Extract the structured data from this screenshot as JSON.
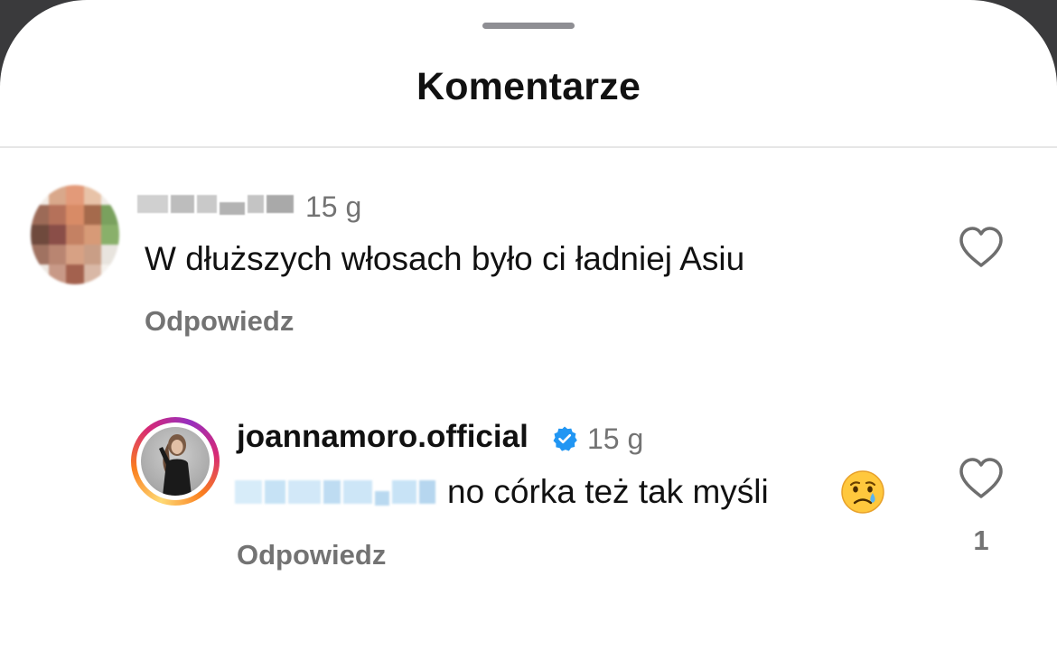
{
  "sheet": {
    "title": "Komentarze"
  },
  "comments": [
    {
      "username_blurred": true,
      "time": "15 g",
      "text": "W dłuższych włosach było ci ładniej Asiu",
      "reply_label": "Odpowiedz"
    }
  ],
  "reply": {
    "username": "joannamoro.official",
    "verified": true,
    "time": "15 g",
    "mention_blurred": true,
    "text": "no córka też tak myśli",
    "emoji": "crying-face",
    "reply_label": "Odpowiedz",
    "like_count": "1"
  },
  "colors": {
    "text": "#111111",
    "secondary": "#737373",
    "verified_blue": "#2196f3",
    "divider": "#e6e6e6"
  }
}
